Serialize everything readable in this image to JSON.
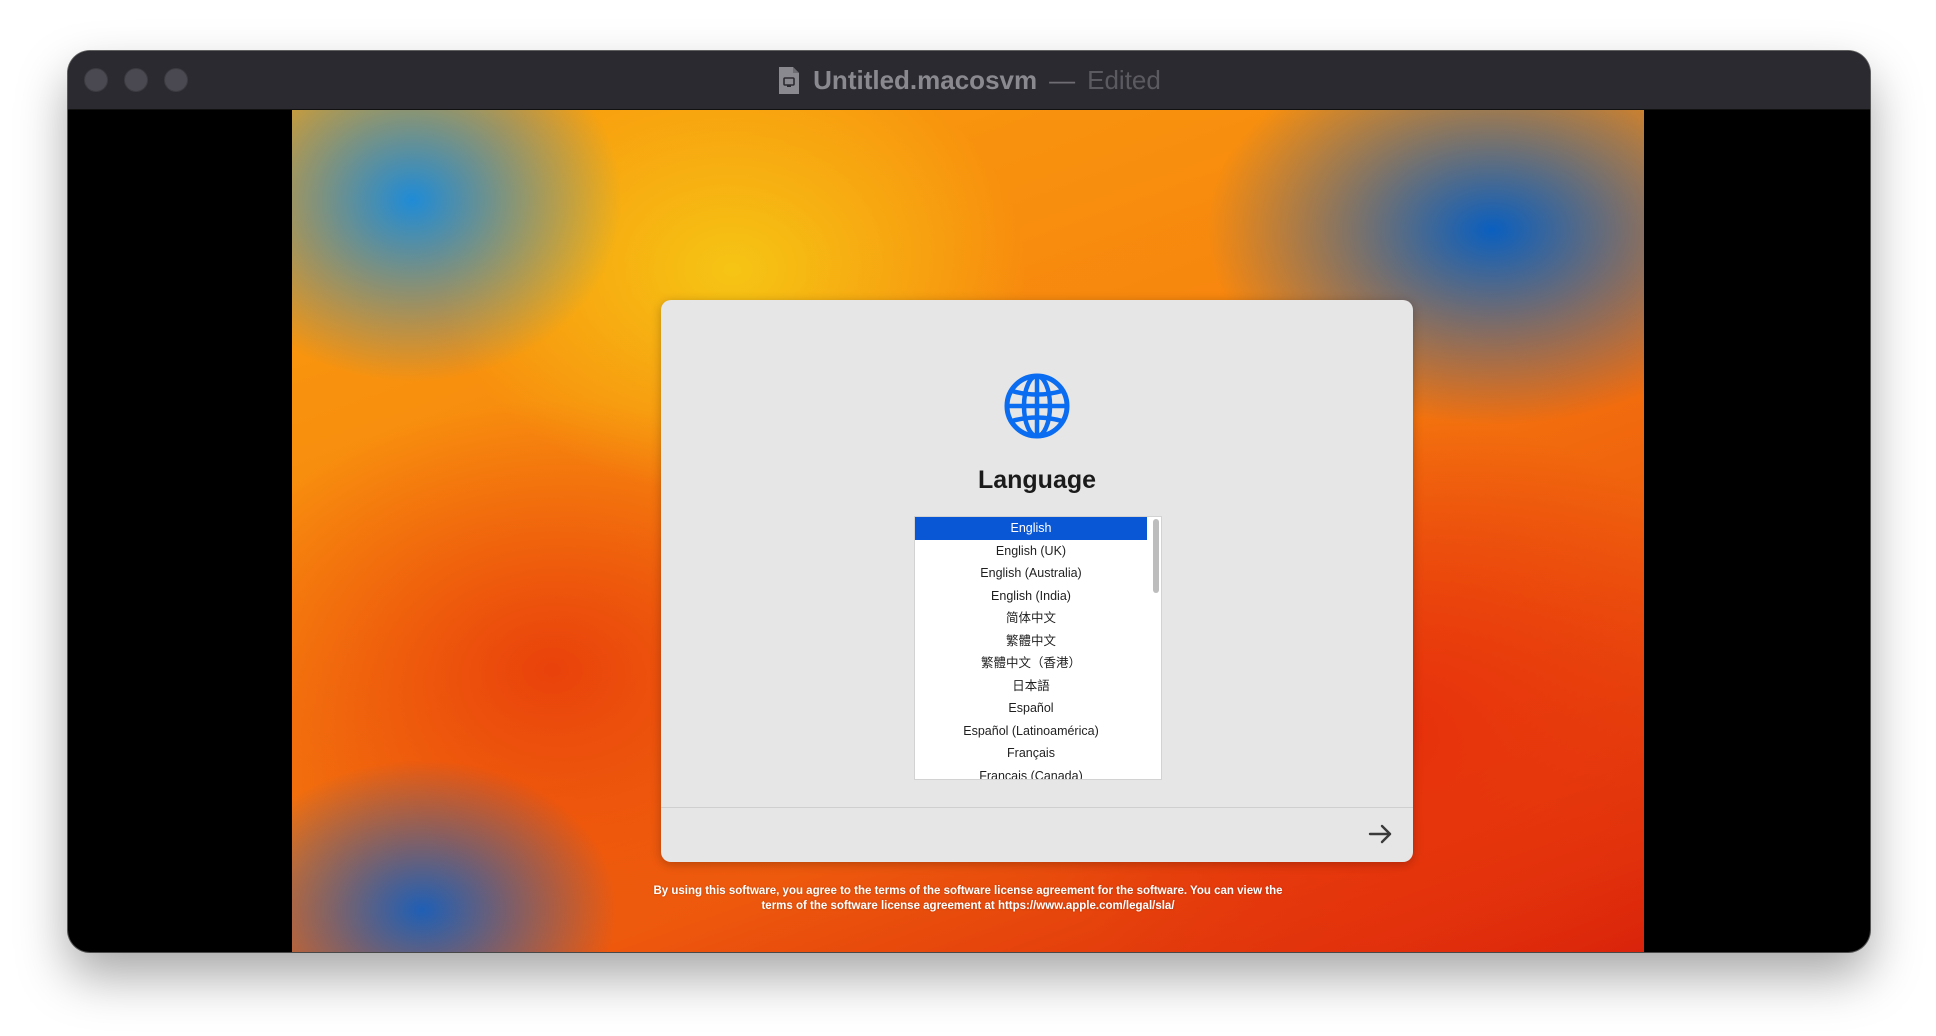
{
  "window": {
    "title_name": "Untitled.macosvm",
    "title_separator": "—",
    "title_status": "Edited"
  },
  "setup": {
    "heading": "Language",
    "languages": [
      "English",
      "English (UK)",
      "English (Australia)",
      "English (India)",
      "简体中文",
      "繁體中文",
      "繁體中文（香港）",
      "日本語",
      "Español",
      "Español (Latinoamérica)",
      "Français",
      "Français (Canada)"
    ],
    "selected_index": 0,
    "license_line1": "By using this software, you agree to the terms of the software license agreement for the software. You can view the",
    "license_line2": "terms of the software license agreement at https://www.apple.com/legal/sla/"
  },
  "icons": {
    "globe": "globe-icon",
    "next": "arrow-right-icon",
    "document": "document-icon"
  },
  "colors": {
    "accent": "#0a57d6",
    "globe": "#0a6cf0"
  }
}
